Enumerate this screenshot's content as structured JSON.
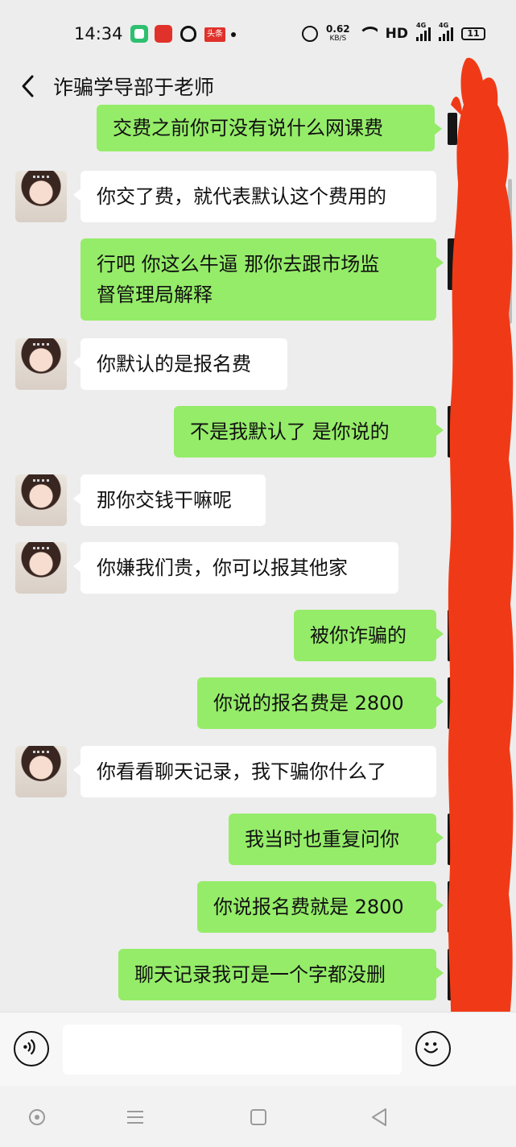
{
  "status_bar": {
    "time": "14:34",
    "app_badge_toutiao": "头条",
    "net_speed": "0.62",
    "net_speed_unit": "KB/S",
    "hd_label": "HD",
    "signal1_label": "4G",
    "signal2_label": "4G",
    "battery": "11"
  },
  "header": {
    "title": "诈骗学导部于老师"
  },
  "messages": [
    {
      "dir": "out",
      "text": "交费之前你可没有说什么网课费"
    },
    {
      "dir": "in",
      "text": "你交了费，就代表默认这个费用的"
    },
    {
      "dir": "out",
      "text": "行吧 你这么牛逼 那你去跟市场监",
      "text2": "督管理局解释"
    },
    {
      "dir": "in",
      "text": "你默认的是报名费"
    },
    {
      "dir": "out",
      "text": "不是我默认了 是你说的"
    },
    {
      "dir": "in",
      "text": "那你交钱干嘛呢"
    },
    {
      "dir": "in",
      "text": "你嫌我们贵，你可以报其他家"
    },
    {
      "dir": "out",
      "text": "被你诈骗的"
    },
    {
      "dir": "out",
      "text": "你说的报名费是 2800"
    },
    {
      "dir": "in",
      "text": "你看看聊天记录，我下骗你什么了"
    },
    {
      "dir": "out",
      "text": "我当时也重复问你"
    },
    {
      "dir": "out",
      "text": "你说报名费就是 2800"
    },
    {
      "dir": "out",
      "text": "聊天记录我可是一个字都没删"
    }
  ],
  "input_bar": {
    "value": "",
    "placeholder": ""
  },
  "colors": {
    "outgoing_bubble": "#95ec69",
    "incoming_bubble": "#ffffff",
    "background": "#ededed",
    "redaction": "#f03a17"
  },
  "icons": [
    "back-chevron-icon",
    "voice-icon",
    "emoji-icon",
    "nav-home-icon",
    "nav-menu-icon",
    "nav-square-icon",
    "nav-back-icon"
  ]
}
